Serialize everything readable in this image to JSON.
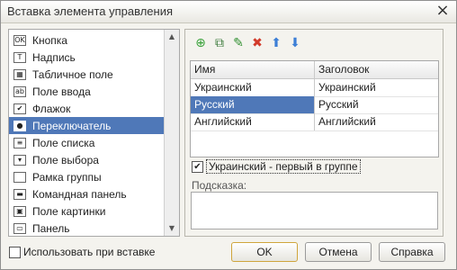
{
  "window": {
    "title": "Вставка элемента управления"
  },
  "list": {
    "items": [
      {
        "label": "Кнопка",
        "icon": "button-icon",
        "glyph": "OK"
      },
      {
        "label": "Надпись",
        "icon": "label-icon",
        "glyph": "T"
      },
      {
        "label": "Табличное поле",
        "icon": "table-icon",
        "glyph": "▦"
      },
      {
        "label": "Поле ввода",
        "icon": "input-field-icon",
        "glyph": "ab"
      },
      {
        "label": "Флажок",
        "icon": "checkbox-icon",
        "glyph": "✔"
      },
      {
        "label": "Переключатель",
        "icon": "radio-icon",
        "glyph": "●",
        "selected": true
      },
      {
        "label": "Поле списка",
        "icon": "listbox-icon",
        "glyph": "≡"
      },
      {
        "label": "Поле выбора",
        "icon": "combobox-icon",
        "glyph": "▾"
      },
      {
        "label": "Рамка группы",
        "icon": "group-frame-icon",
        "glyph": ""
      },
      {
        "label": "Командная панель",
        "icon": "command-bar-icon",
        "glyph": "▬"
      },
      {
        "label": "Поле картинки",
        "icon": "picture-icon",
        "glyph": "▣"
      },
      {
        "label": "Панель",
        "icon": "panel-icon",
        "glyph": "▭"
      }
    ]
  },
  "toolbar": {
    "buttons": [
      {
        "name": "add-icon",
        "glyph": "⊕",
        "color": "#3aa23a"
      },
      {
        "name": "copy-icon",
        "glyph": "⧉",
        "color": "#3a7a3a"
      },
      {
        "name": "edit-icon",
        "glyph": "✎",
        "color": "#2f8f2f"
      },
      {
        "name": "delete-icon",
        "glyph": "✖",
        "color": "#d23a2a"
      },
      {
        "name": "move-up-icon",
        "glyph": "⬆",
        "color": "#3d7fd6"
      },
      {
        "name": "move-down-icon",
        "glyph": "⬇",
        "color": "#3d7fd6"
      }
    ]
  },
  "grid": {
    "columns": [
      "Имя",
      "Заголовок"
    ],
    "rows": [
      [
        "Украинский",
        "Украинский"
      ],
      [
        "Русский",
        "Русский"
      ],
      [
        "Английский",
        "Английский"
      ]
    ],
    "selected_row": 1
  },
  "first_in_group": {
    "label": "Украинский - первый в группе",
    "checked": true
  },
  "hint": {
    "label": "Подсказка:",
    "value": ""
  },
  "use_on_insert": {
    "label": "Использовать при вставке",
    "checked": false
  },
  "buttons": {
    "ok": "OK",
    "cancel": "Отмена",
    "help": "Справка"
  },
  "colors": {
    "selection": "#4f78b8",
    "default_button_border": "#cfa53c"
  }
}
